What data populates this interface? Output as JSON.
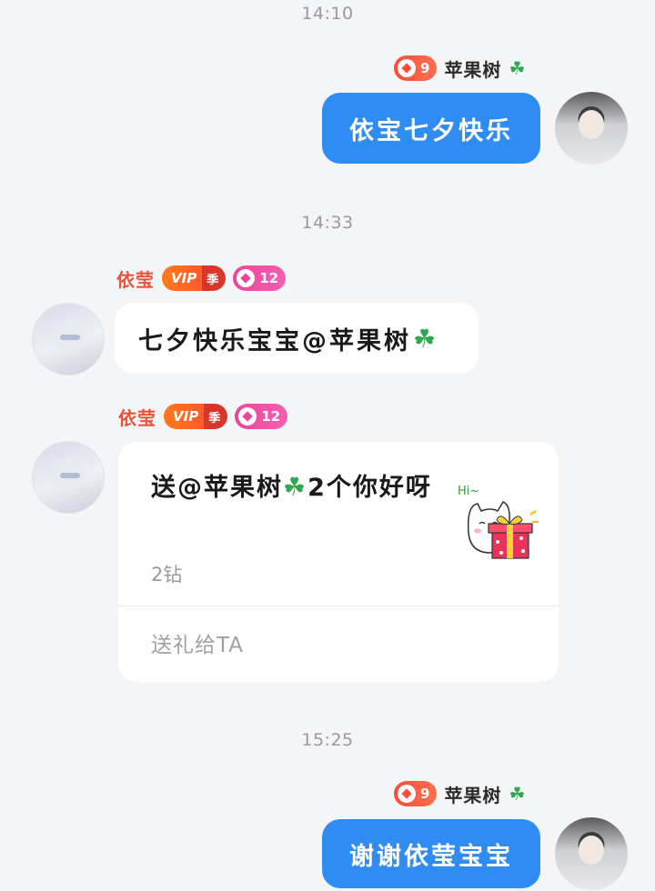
{
  "times": [
    "14:10",
    "14:33",
    "15:25"
  ],
  "me": {
    "name": "苹果树",
    "level": "9"
  },
  "her": {
    "name": "依莹",
    "vip_label": "VIP",
    "vip_season": "季",
    "level": "12"
  },
  "messages": {
    "m1": "依宝七夕快乐",
    "m2": "七夕快乐宝宝@苹果树",
    "m3": "谢谢依莹宝宝"
  },
  "gift": {
    "text": "送@苹果树",
    "text_tail": "2个你好呀",
    "sticker_hi": "Hi~",
    "price": "2钻",
    "send_label": "送礼给TA"
  },
  "icons": {
    "clover": "four-leaf-clover-icon",
    "gem": "diamond-level-icon"
  },
  "colors": {
    "my_bubble": "#2f8cf3",
    "page_bg": "#f4f5f7",
    "her_name": "#e8553b"
  }
}
